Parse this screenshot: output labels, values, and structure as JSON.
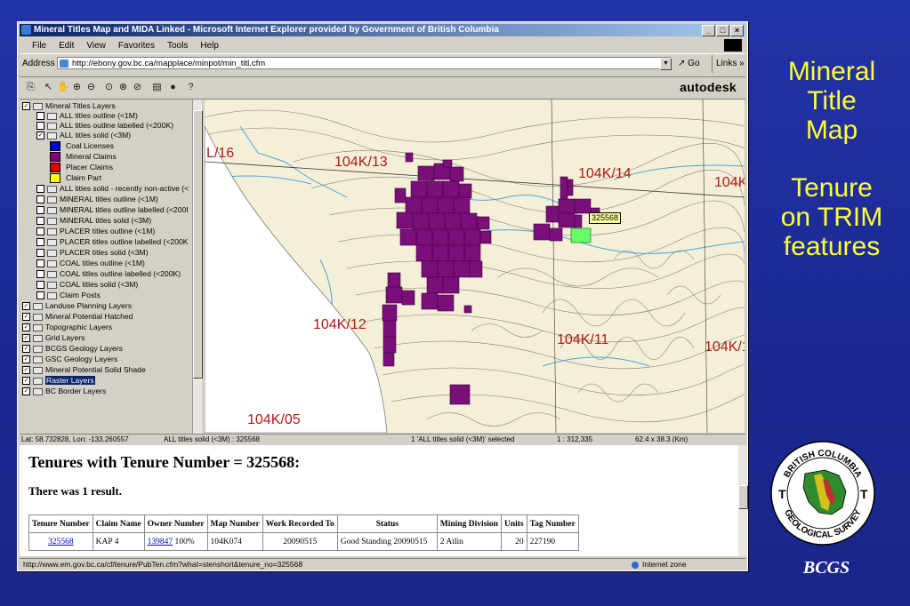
{
  "browser": {
    "title": "Mineral Titles Map and MIDA Linked - Microsoft Internet Explorer provided by Government of British Columbia",
    "menu": [
      "File",
      "Edit",
      "View",
      "Favorites",
      "Tools",
      "Help"
    ],
    "address_label": "Address",
    "address_value": "http://ebony.gov.bc.ca/mapplace/minpot/min_titl.cfm",
    "go_label": "Go",
    "links_label": "Links »"
  },
  "viewer": {
    "brand": "autodesk"
  },
  "layers": [
    {
      "label": "Mineral Titles Layers",
      "checked": true,
      "indent": 0,
      "type": "group"
    },
    {
      "label": "ALL titles outline (<1M)",
      "checked": false,
      "indent": 1,
      "type": "layer"
    },
    {
      "label": "ALL titles outline labelled (<200K)",
      "checked": false,
      "indent": 1,
      "type": "layer"
    },
    {
      "label": "ALL titles solid (<3M)",
      "checked": true,
      "indent": 1,
      "type": "layer"
    },
    {
      "label": "Coal Licenses",
      "indent": 2,
      "type": "legend",
      "color": "#0000cc"
    },
    {
      "label": "Mineral Claims",
      "indent": 2,
      "type": "legend",
      "color": "#800080"
    },
    {
      "label": "Placer Claims",
      "indent": 2,
      "type": "legend",
      "color": "#e00000"
    },
    {
      "label": "Claim Part",
      "indent": 2,
      "type": "legend",
      "color": "#ffff00"
    },
    {
      "label": "ALL titles solid - recently non-active (<",
      "checked": false,
      "indent": 1,
      "type": "layer"
    },
    {
      "label": "MINERAL titles outline (<1M)",
      "checked": false,
      "indent": 1,
      "type": "layer"
    },
    {
      "label": "MINERAL titles outline labelled (<200I",
      "checked": false,
      "indent": 1,
      "type": "layer"
    },
    {
      "label": "MINERAL titles solid (<3M)",
      "checked": false,
      "indent": 1,
      "type": "layer"
    },
    {
      "label": "PLACER titles outline (<1M)",
      "checked": false,
      "indent": 1,
      "type": "layer"
    },
    {
      "label": "PLACER titles outline labelled (<200K",
      "checked": false,
      "indent": 1,
      "type": "layer"
    },
    {
      "label": "PLACER titles solid (<3M)",
      "checked": false,
      "indent": 1,
      "type": "layer"
    },
    {
      "label": "COAL titles outline (<1M)",
      "checked": false,
      "indent": 1,
      "type": "layer"
    },
    {
      "label": "COAL titles outline labelled (<200K)",
      "checked": false,
      "indent": 1,
      "type": "layer"
    },
    {
      "label": "COAL titles solid (<3M)",
      "checked": false,
      "indent": 1,
      "type": "layer"
    },
    {
      "label": "Claim Posts",
      "checked": false,
      "indent": 1,
      "type": "layer"
    },
    {
      "label": "Landuse Planning Layers",
      "checked": true,
      "indent": 0,
      "type": "group"
    },
    {
      "label": "Mineral Potential Hatched",
      "checked": true,
      "indent": 0,
      "type": "group"
    },
    {
      "label": "Topographic Layers",
      "checked": true,
      "indent": 0,
      "type": "group"
    },
    {
      "label": "Grid Layers",
      "checked": true,
      "indent": 0,
      "type": "group"
    },
    {
      "label": "BCGS Geology Layers",
      "checked": true,
      "indent": 0,
      "type": "group"
    },
    {
      "label": "GSC Geology Layers",
      "checked": true,
      "indent": 0,
      "type": "group"
    },
    {
      "label": "Mineral Potential Solid Shade",
      "checked": true,
      "indent": 0,
      "type": "group"
    },
    {
      "label": "Raster Layers",
      "checked": true,
      "indent": 0,
      "type": "group",
      "selected": true
    },
    {
      "label": "BC Border Layers",
      "checked": true,
      "indent": 0,
      "type": "group"
    }
  ],
  "map": {
    "labels": [
      "L/16",
      "104K/13",
      "104K/14",
      "104K/",
      "104K/12",
      "104K/11",
      "104K/1(",
      "104K/05"
    ],
    "selected_tag": "325568"
  },
  "map_status": {
    "coords": "Lat: 58.732828, Lon: -133.260557",
    "layer": "ALL titles solid (<3M) : 325568",
    "selection": "1 'ALL titles solid (<3M)' selected",
    "scale": "1 : 312,335",
    "extent": "62.4 x 38.3 (Km)"
  },
  "results": {
    "heading": "Tenures with Tenure Number = 325568:",
    "count_text": "There was 1 result.",
    "columns": [
      "Tenure Number",
      "Claim Name",
      "Owner Number",
      "Map Number",
      "Work Recorded To",
      "Status",
      "Mining Division",
      "Units",
      "Tag Number"
    ],
    "row": {
      "tenure_number": "325568",
      "claim_name": "KAP 4",
      "owner_number": "139847",
      "owner_pct": "100%",
      "map_number": "104K074",
      "work_recorded_to": "20090515",
      "status": "Good Standing 20090515",
      "mining_division": "2 Atlin",
      "units": "20",
      "tag_number": "227190"
    }
  },
  "statusbar": {
    "url": "http://www.em.gov.bc.ca/cf/tenure/PubTen.cfm?what=stenshort&tenure_no=325568",
    "zone": "Internet zone"
  },
  "slide": {
    "line1": "Mineral",
    "line2": "Title",
    "line3": "Map",
    "line4": "Tenure",
    "line5": "on TRIM",
    "line6": "features",
    "logo_caption": "BCGS",
    "logo_top_text": "BRITISH COLUMBIA",
    "logo_bottom_text": "GEOLOGICAL SURVEY"
  },
  "colors": {
    "slide_bg": "#1e2a9c",
    "side_text": "#ffff33",
    "claims": "#7a0f7a",
    "selected_claim": "#66ff66",
    "map_label": "#b01818"
  }
}
